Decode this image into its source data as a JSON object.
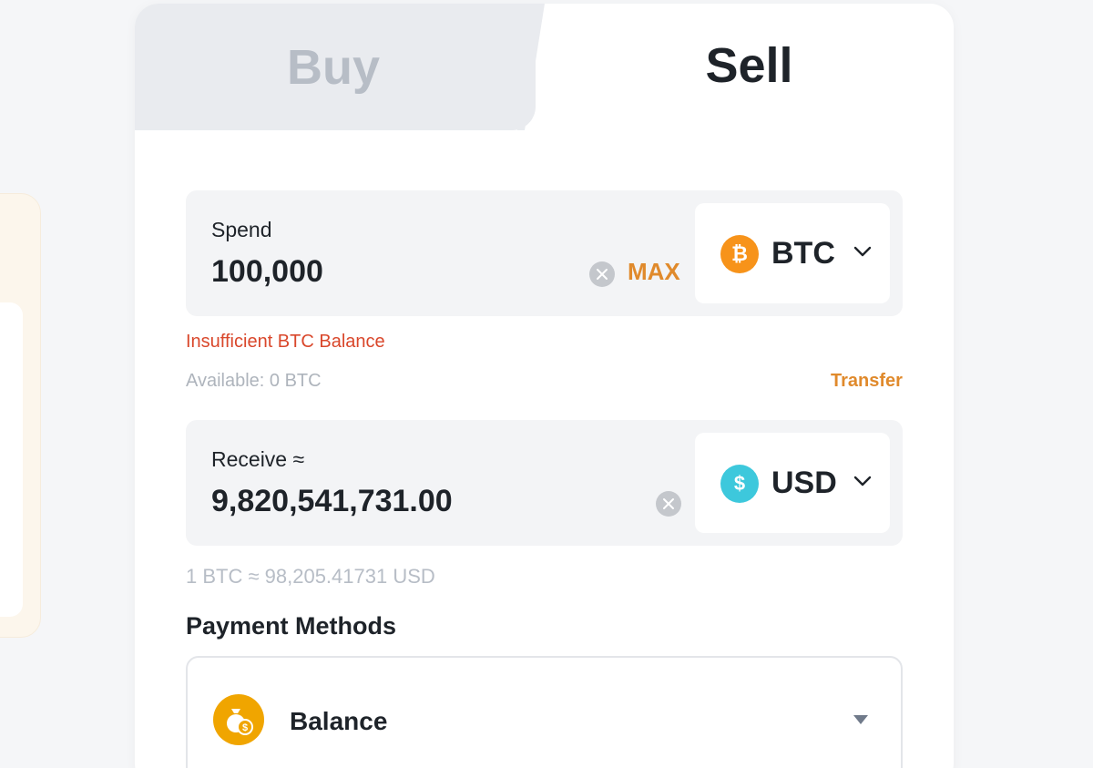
{
  "tabs": {
    "buy_label": "Buy",
    "sell_label": "Sell",
    "active": "Sell"
  },
  "spend": {
    "label": "Spend",
    "value": "100,000",
    "max_label": "MAX",
    "coin": {
      "symbol": "BTC",
      "icon": "bitcoin-icon",
      "icon_glyph": "₿",
      "color": "#f7931a"
    }
  },
  "error_text": "Insufficient BTC Balance",
  "available_text": "Available: 0 BTC",
  "transfer_label": "Transfer",
  "receive": {
    "label": "Receive ≈",
    "value": "9,820,541,731.00",
    "coin": {
      "symbol": "USD",
      "icon": "dollar-icon",
      "icon_glyph": "$",
      "color": "#3dc8dc"
    }
  },
  "rate_text": "1 BTC ≈ 98,205.41731 USD",
  "payment_methods": {
    "title": "Payment Methods",
    "selected": {
      "label": "Balance",
      "icon": "money-bag-icon",
      "color": "#f0a500"
    }
  },
  "colors": {
    "accent": "#e08a2c",
    "error": "#d9472b",
    "muted": "#b7bdc6"
  }
}
